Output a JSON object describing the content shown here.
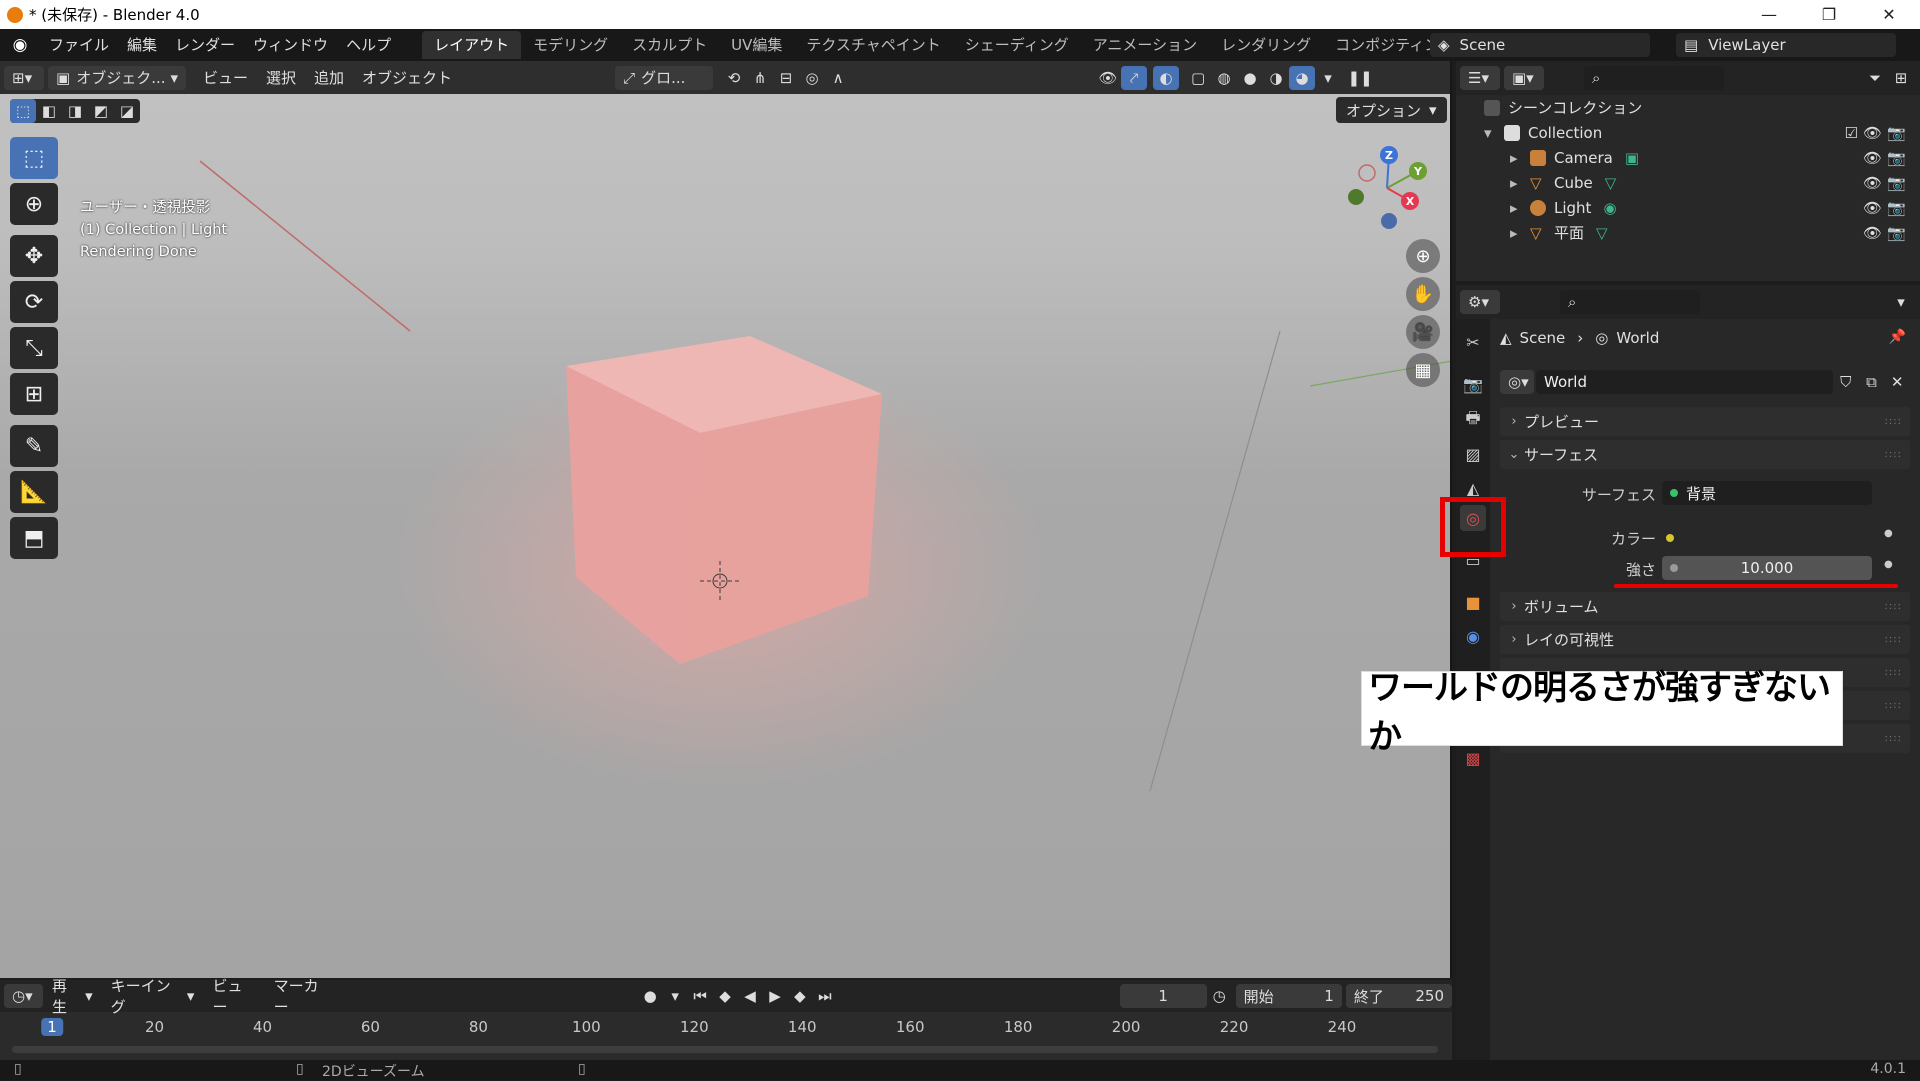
{
  "window": {
    "title": "* (未保存) - Blender 4.0",
    "minimize": "—",
    "maximize": "❐",
    "close": "✕"
  },
  "menus": [
    "ファイル",
    "編集",
    "レンダー",
    "ウィンドウ",
    "ヘルプ"
  ],
  "workspaces": [
    "レイアウト",
    "モデリング",
    "スカルプト",
    "UV編集",
    "テクスチャペイント",
    "シェーディング",
    "アニメーション",
    "レンダリング",
    "コンポジティング"
  ],
  "active_workspace": "レイアウト",
  "scene_field": "Scene",
  "viewlayer_field": "ViewLayer",
  "viewport": {
    "mode": "オブジェク...",
    "menu": [
      "ビュー",
      "選択",
      "追加",
      "オブジェクト"
    ],
    "transform": "グロ...",
    "options": "オプション",
    "overlay_lines": [
      "ユーザー・透視投影",
      "(1) Collection | Light",
      "Rendering Done"
    ],
    "gizmo": {
      "z": "Z",
      "y": "Y",
      "x": "X"
    }
  },
  "timeline": {
    "menu": [
      "再生",
      "キーイング",
      "ビュー",
      "マーカー"
    ],
    "current_frame": "1",
    "start_label": "開始",
    "start": "1",
    "end_label": "終了",
    "end": "250",
    "ticks": [
      "1",
      "20",
      "40",
      "60",
      "80",
      "100",
      "120",
      "140",
      "160",
      "180",
      "200",
      "220",
      "240"
    ]
  },
  "status": {
    "hint": "2Dビューズーム",
    "version": "4.0.1"
  },
  "outliner": {
    "root": "シーンコレクション",
    "collection": "Collection",
    "items": [
      {
        "name": "Camera",
        "icon": "camera-icon"
      },
      {
        "name": "Cube",
        "icon": "mesh-icon"
      },
      {
        "name": "Light",
        "icon": "light-icon"
      },
      {
        "name": "平面",
        "icon": "mesh-icon"
      }
    ]
  },
  "properties": {
    "breadcrumb": [
      "Scene",
      "World"
    ],
    "world_name": "World",
    "panels": [
      "プレビュー",
      "サーフェス",
      "ボリューム",
      "レイの可視性"
    ],
    "surface_label": "サーフェス",
    "surface_value": "背景",
    "color_label": "カラー",
    "strength_label": "強さ",
    "strength_value": "10.000"
  },
  "callout": "ワールドの明るさが強すぎないか",
  "colors": {
    "accent": "#4772b3",
    "highlight": "#e60000",
    "cube": "#e8a19e"
  }
}
